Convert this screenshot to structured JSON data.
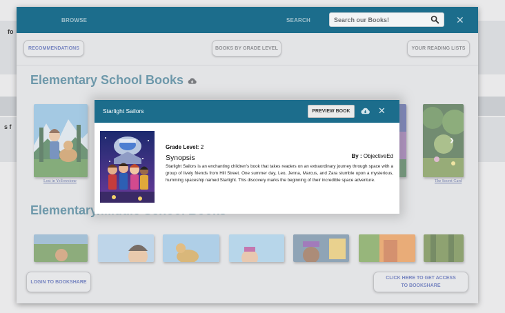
{
  "nav": {
    "browse_label": "BROWSE",
    "search_label": "SEARCH",
    "search_placeholder": "Search our Books!"
  },
  "subnav": {
    "recommendations": "RECOMMENDATIONS",
    "by_grade": "BOOKS BY GRADE LEVEL",
    "reading_lists": "YOUR READING LISTS"
  },
  "sections": [
    {
      "title": "Elementary School Books",
      "visible_captions": [
        "Lost in Yellowstone",
        "The Secret Gard"
      ]
    },
    {
      "title": "Elementary/Middle School Books"
    }
  ],
  "buttons": {
    "login": "LOGIN TO BOOKSHARE",
    "access": "CLICK HERE TO GET ACCESS TO BOOKSHARE"
  },
  "background_text": [
    "fo",
    "s f"
  ],
  "modal": {
    "title": "Starlight Sailors",
    "preview_label": "PREVIEW BOOK",
    "grade_label": "Grade Level:",
    "grade_value": "2",
    "by_label": "By :",
    "author": "ObjectiveEd",
    "synopsis_heading": "Synopsis",
    "synopsis": "Starlight Sailors is an enchanting children's book that takes readers on an extraordinary journey through space with a group of lively friends from Hill Street. One summer day, Leo, Jenna, Marcus, and Zara stumble upon a mysterious, humming spaceship named Starlight. This discovery marks the beginning of their incredible space adventure."
  },
  "colors": {
    "header_blue": "#1c6d8c",
    "title_blue": "#2a6c86",
    "link_blue": "#3a4fa8"
  },
  "icons": [
    "search-icon",
    "close-icon",
    "cloud-download-icon",
    "chevron-right-icon"
  ]
}
